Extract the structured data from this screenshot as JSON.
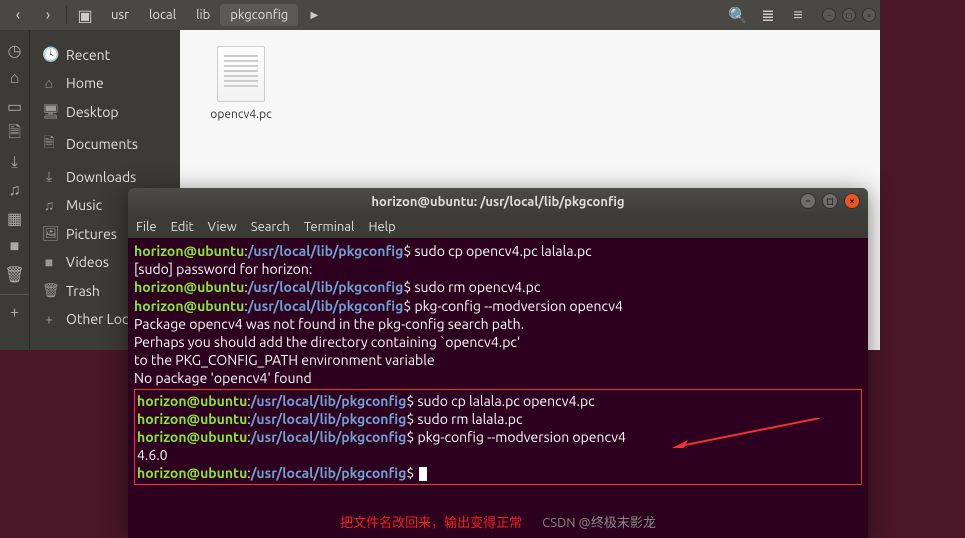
{
  "file_manager": {
    "breadcrumb": [
      "usr",
      "local",
      "lib",
      "pkgconfig"
    ],
    "active_crumb": "pkgconfig",
    "sidebar": [
      {
        "icon": "🕓",
        "label": "Recent"
      },
      {
        "icon": "⌂",
        "label": "Home"
      },
      {
        "icon": "🖥",
        "label": "Desktop"
      },
      {
        "icon": "🗎",
        "label": "Documents"
      },
      {
        "icon": "⤓",
        "label": "Downloads"
      },
      {
        "icon": "♫",
        "label": "Music"
      },
      {
        "icon": "🖼",
        "label": "Pictures"
      },
      {
        "icon": "■",
        "label": "Videos"
      },
      {
        "icon": "🗑",
        "label": "Trash"
      },
      {
        "icon": "+",
        "label": "Other Locations"
      }
    ],
    "files": [
      {
        "name": "opencv4.pc"
      }
    ]
  },
  "terminal": {
    "title": "horizon@ubuntu: /usr/local/lib/pkgconfig",
    "menu": [
      "File",
      "Edit",
      "View",
      "Search",
      "Terminal",
      "Help"
    ],
    "prompt_user": "horizon@ubuntu",
    "prompt_path": "/usr/local/lib/pkgconfig",
    "lines_top": [
      {
        "type": "cmd",
        "cmd": "sudo cp opencv4.pc lalala.pc"
      },
      {
        "type": "out",
        "text": "[sudo] password for horizon:"
      },
      {
        "type": "cmd",
        "cmd": "sudo rm opencv4.pc"
      },
      {
        "type": "cmd",
        "cmd": "pkg-config --modversion opencv4"
      },
      {
        "type": "out",
        "text": "Package opencv4 was not found in the pkg-config search path."
      },
      {
        "type": "out",
        "text": "Perhaps you should add the directory containing `opencv4.pc'"
      },
      {
        "type": "out",
        "text": "to the PKG_CONFIG_PATH environment variable"
      },
      {
        "type": "out",
        "text": "No package 'opencv4' found"
      }
    ],
    "lines_box": [
      {
        "type": "cmd",
        "cmd": "sudo cp lalala.pc opencv4.pc"
      },
      {
        "type": "cmd",
        "cmd": "sudo rm lalala.pc"
      },
      {
        "type": "cmd",
        "cmd": "pkg-config --modversion opencv4"
      },
      {
        "type": "out",
        "text": "4.6.0"
      },
      {
        "type": "cmd",
        "cmd": "",
        "cursor": true
      }
    ],
    "annotation": "把文件名改回来，输出变得正常",
    "watermark": "CSDN @终极末影龙"
  }
}
